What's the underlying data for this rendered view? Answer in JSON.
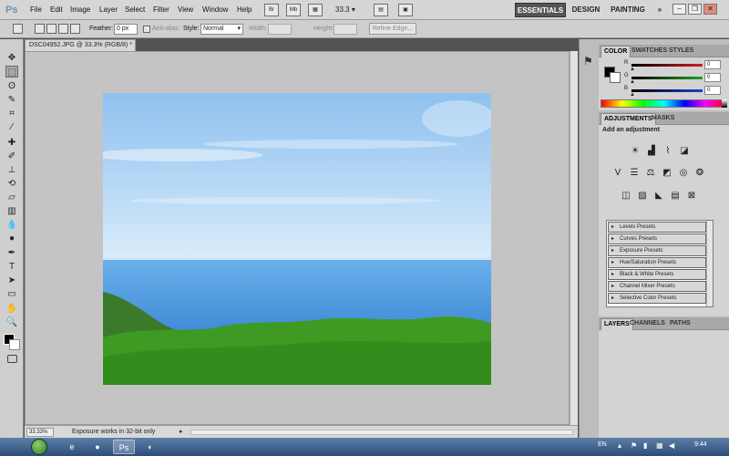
{
  "app": {
    "logo": "Ps"
  },
  "menu": [
    "File",
    "Edit",
    "Image",
    "Layer",
    "Select",
    "Filter",
    "View",
    "Window",
    "Help"
  ],
  "appbar": {
    "bridge_label": "Br",
    "minibridge_label": "Mb",
    "zoom_value": "33.3",
    "workspaces": {
      "essentials": "ESSENTIALS",
      "design": "DESIGN",
      "painting": "PAINTING",
      "more": "»"
    }
  },
  "options": {
    "feather_label": "Feather:",
    "feather_value": "0 px",
    "antialias_label": "Anti-alias",
    "style_label": "Style:",
    "style_value": "Normal",
    "width_label": "Width:",
    "height_label": "Height:",
    "refine_label": "Refine Edge..."
  },
  "document": {
    "tab_title": "DSC04952.JPG @ 33.3% (RGB/8) *",
    "zoom_status": "33.33%",
    "status_message": "Exposure works in 32-bit only"
  },
  "color_panel": {
    "tabs": [
      "COLOR",
      "SWATCHES",
      "STYLES"
    ],
    "channels": [
      {
        "label": "R",
        "value": "0",
        "color": "#d02020"
      },
      {
        "label": "G",
        "value": "0",
        "color": "#20a020"
      },
      {
        "label": "B",
        "value": "0",
        "color": "#2040d0"
      }
    ]
  },
  "adjustments_panel": {
    "tabs": [
      "ADJUSTMENTS",
      "MASKS"
    ],
    "title": "Add an adjustment",
    "presets": [
      "Levels Presets",
      "Curves Presets",
      "Exposure Presets",
      "Hue/Saturation Presets",
      "Black & White Presets",
      "Channel Mixer Presets",
      "Selective Color Presets"
    ]
  },
  "layers_panel": {
    "tabs": [
      "LAYERS",
      "CHANNELS",
      "PATHS"
    ]
  },
  "taskbar": {
    "language": "EN",
    "clock": "9:44"
  }
}
